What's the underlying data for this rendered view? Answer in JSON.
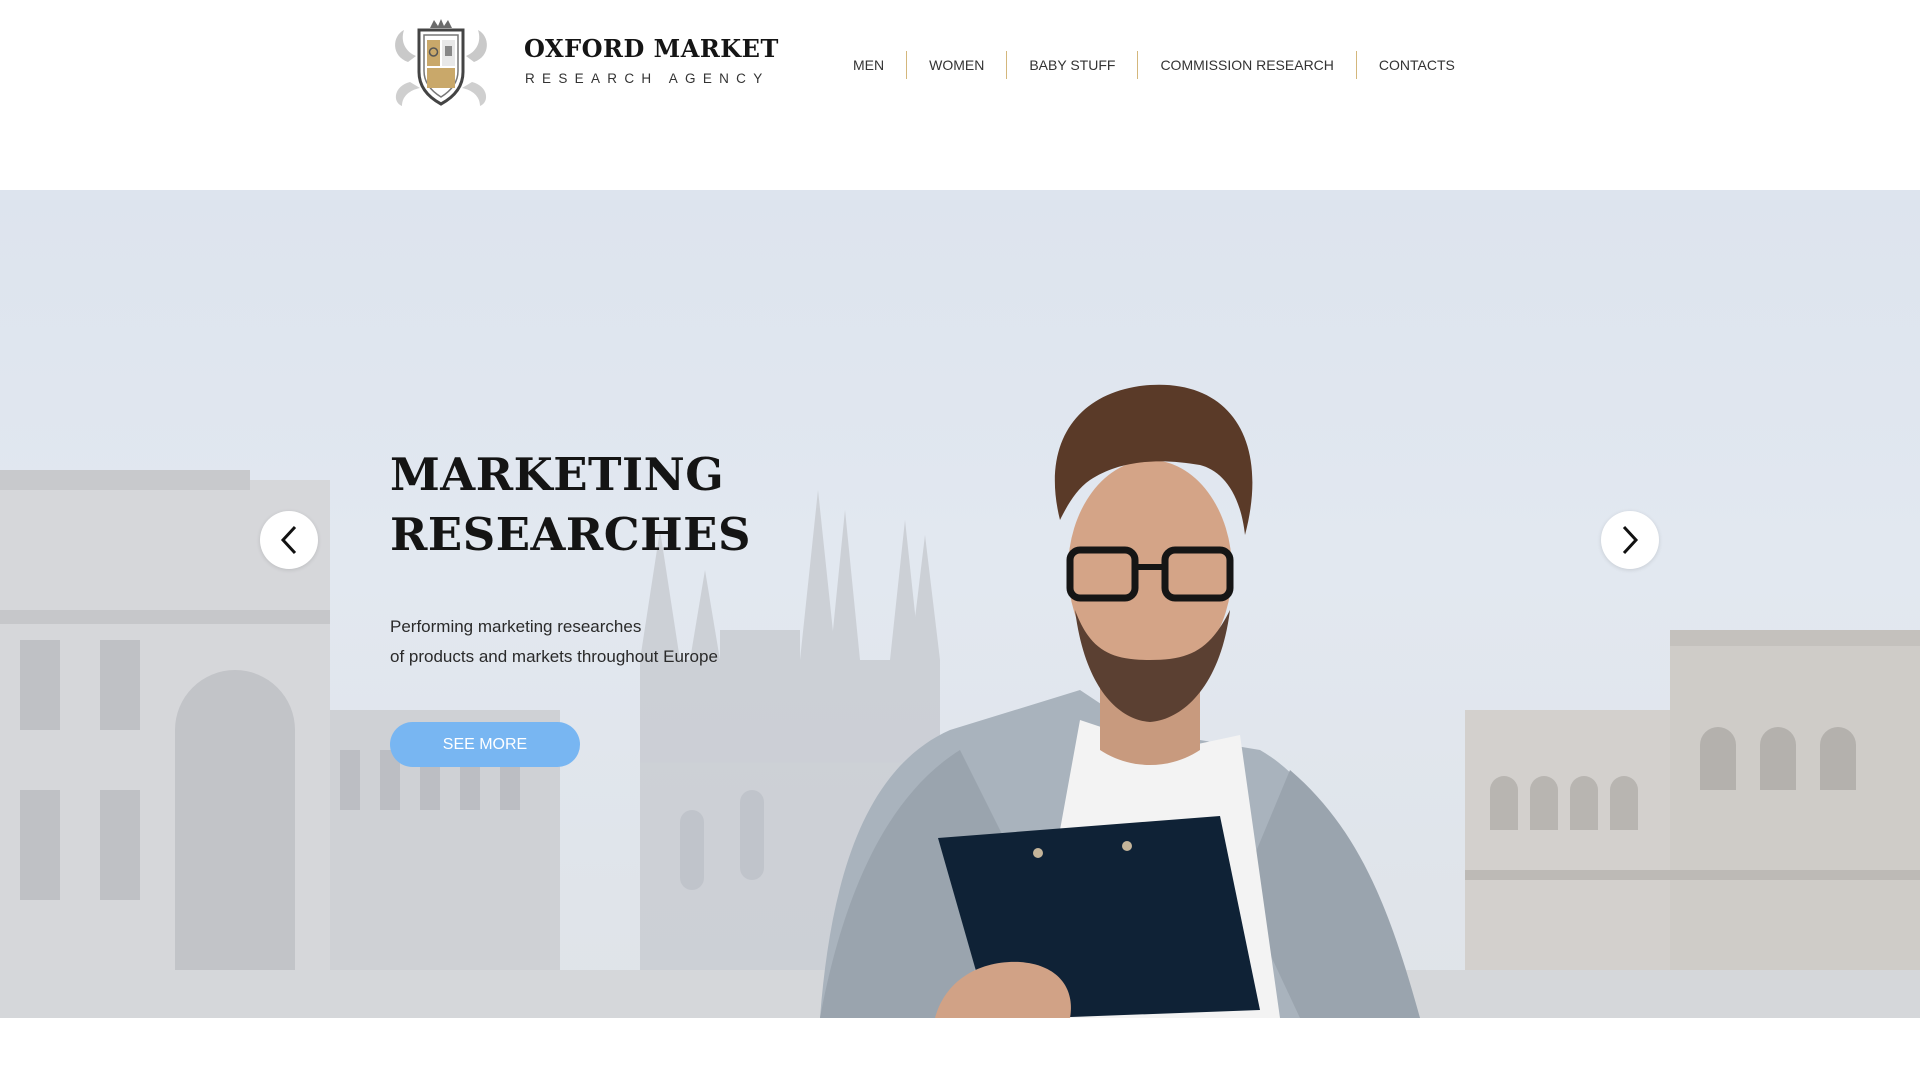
{
  "brand": {
    "name": "OXFORD MARKET",
    "tagline": "RESEARCH AGENCY",
    "logo_icon": "crest-shield-icon"
  },
  "nav": {
    "items": [
      {
        "label": "MEN"
      },
      {
        "label": "WOMEN"
      },
      {
        "label": "BABY STUFF"
      },
      {
        "label": "COMMISSION RESEARCH"
      },
      {
        "label": "CONTACTS"
      }
    ],
    "separator_color": "#d4b77c"
  },
  "hero": {
    "title_line1": "MARKETING",
    "title_line2": "RESEARCHES",
    "subtitle_line1": "Performing marketing researches",
    "subtitle_line2": "of products and markets throughout Europe",
    "cta_label": "SEE MORE",
    "cta_color": "#78b6f2",
    "prev_icon": "chevron-left-icon",
    "next_icon": "chevron-right-icon",
    "image": "man-in-glasses-holding-clipboard-city-square"
  }
}
